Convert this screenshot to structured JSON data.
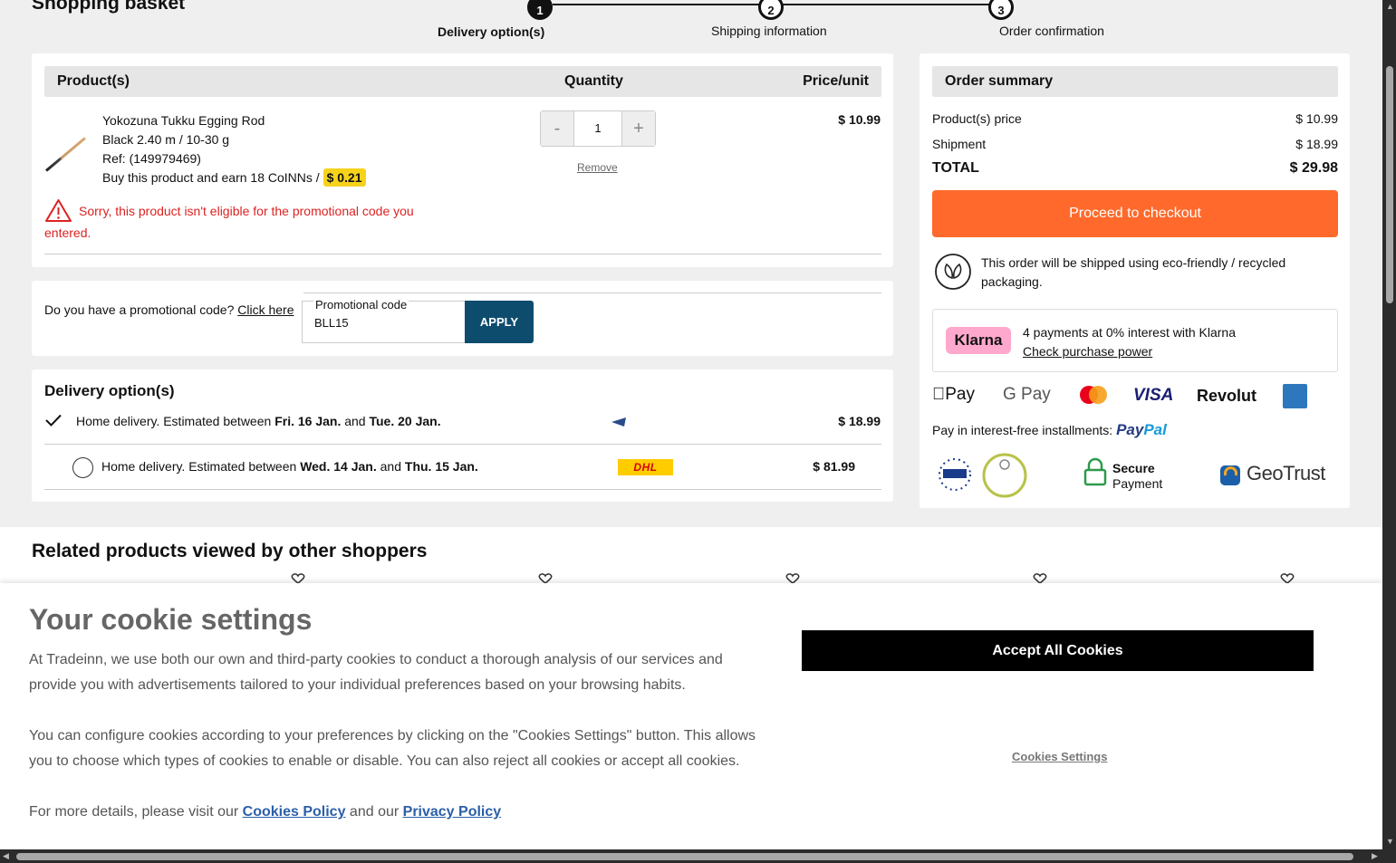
{
  "header": {
    "title": "Shopping basket"
  },
  "steps": [
    {
      "num": "1",
      "label": "Delivery option(s)"
    },
    {
      "num": "2",
      "label": "Shipping information"
    },
    {
      "num": "3",
      "label": "Order confirmation"
    }
  ],
  "products": {
    "headers": {
      "product": "Product(s)",
      "quantity": "Quantity",
      "price": "Price/unit"
    },
    "item": {
      "name": "Yokozuna Tukku Egging Rod",
      "variant": "Black 2.40 m / 10-30 g",
      "ref": "Ref: (149979469)",
      "coins_text": "Buy this product and earn 18 CoINNs / ",
      "coins_value": "$ 0.21",
      "quantity": "1",
      "decrement": "-",
      "increment": "+",
      "remove": "Remove",
      "unit_price": "$ 10.99",
      "warning": "Sorry, this product isn't eligible for the promotional code you entered."
    }
  },
  "promo": {
    "question": "Do you have a promotional code?",
    "link": "Click here",
    "field_label": "Promotional code",
    "field_value": "BLL15",
    "apply": "APPLY"
  },
  "delivery": {
    "title": "Delivery option(s)",
    "options": [
      {
        "prefix": "Home delivery. Estimated between ",
        "from": "Fri. 16 Jan.",
        "and": " and ",
        "to": "Tue. 20 Jan.",
        "carrier": "UNITED STATES POSTAL SERVICE",
        "price": "$ 18.99",
        "selected": true
      },
      {
        "prefix": "Home delivery. Estimated between ",
        "from": "Wed. 14 Jan.",
        "and": " and ",
        "to": "Thu. 15 Jan.",
        "carrier": "DHL",
        "price": "$ 81.99",
        "selected": false
      }
    ]
  },
  "summary": {
    "title": "Order summary",
    "product_price_label": "Product(s) price",
    "product_price": "$ 10.99",
    "shipment_label": "Shipment",
    "shipment": "$ 18.99",
    "total_label": "TOTAL",
    "total": "$ 29.98",
    "checkout": "Proceed to checkout",
    "eco": "This order will be shipped using eco-friendly / recycled packaging.",
    "klarna_badge": "Klarna",
    "klarna_text": "4 payments at 0% interest with Klarna",
    "klarna_link": "Check purchase power",
    "payment_logos": [
      "Pay",
      "G Pay",
      "VISA",
      "Revolut"
    ],
    "installments": "Pay in interest-free installments:",
    "paypal_a": "Pay",
    "paypal_b": "Pal",
    "secure_1": "Secure",
    "secure_2": "Payment",
    "geotrust": "GeoTrust"
  },
  "related": {
    "title": "Related products viewed by other shoppers"
  },
  "cookie": {
    "title": "Your cookie settings",
    "p1": "At Tradeinn, we use both our own and third-party cookies to conduct a thorough analysis of our services and provide you with advertisements tailored to your individual preferences based on your browsing habits.",
    "p2": "You can configure cookies according to your preferences by clicking on the \"Cookies Settings\" button. This allows you to choose which types of cookies to enable or disable. You can also reject all cookies or accept all cookies.",
    "p3_prefix": "For more details, please visit our ",
    "policy_link": "Cookies Policy",
    "p3_and": " and our ",
    "privacy_link": "Privacy Policy",
    "accept": "Accept All Cookies",
    "settings": "Cookies Settings"
  },
  "colors": {
    "checkout": "#ff6a2c",
    "apply": "#0e4c6e",
    "warning": "#dd2222",
    "coins": "#f6d21a",
    "klarna": "#ffa8cd"
  }
}
